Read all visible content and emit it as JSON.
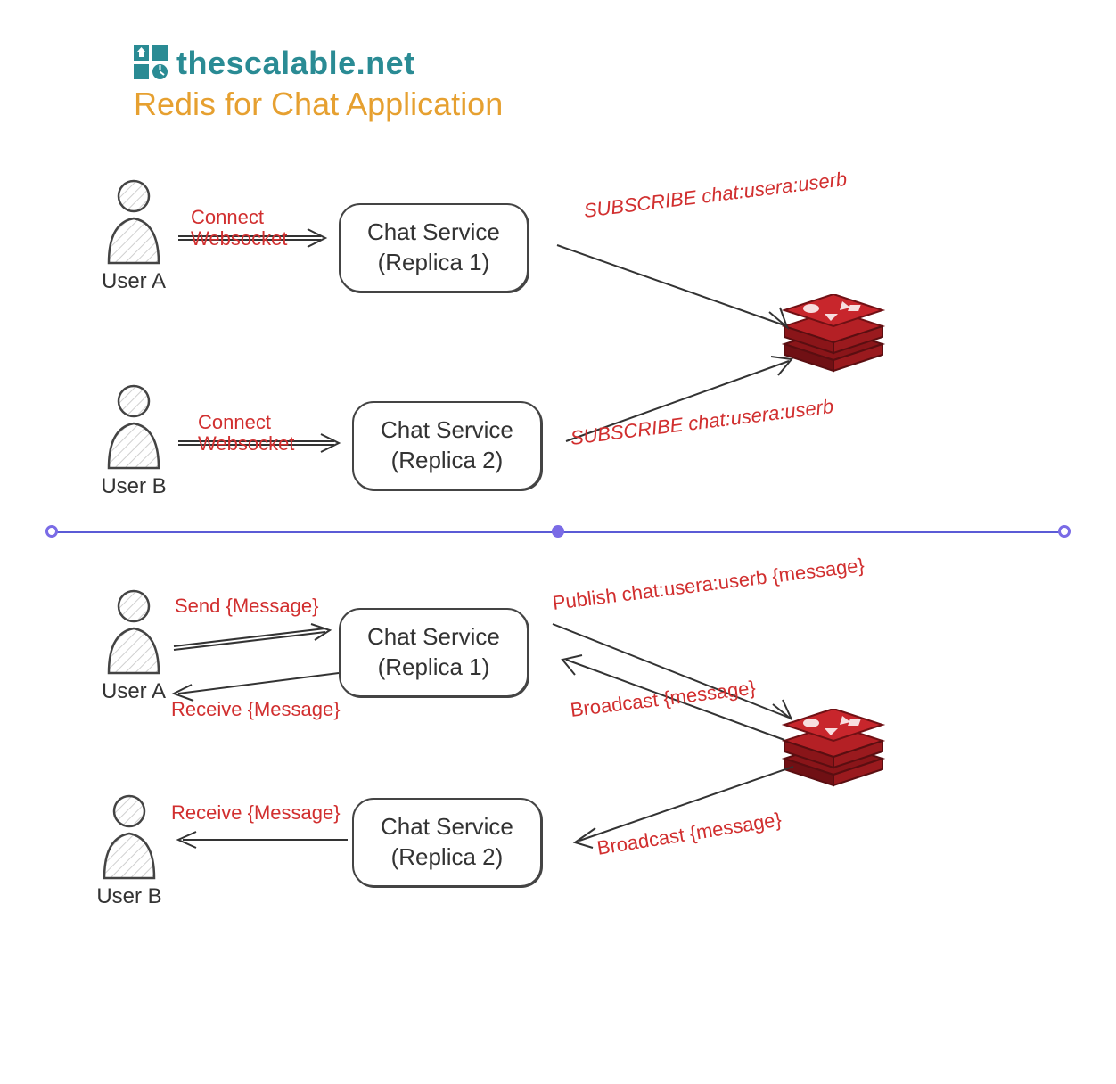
{
  "brand": "thescalable.net",
  "title": "Redis for Chat Application",
  "colors": {
    "brand_teal": "#2a8b94",
    "title_orange": "#e6a030",
    "annotation_red": "#d12f2f",
    "redis_red": "#b42025",
    "divider_purple": "#7a6be6",
    "stroke_black": "#333"
  },
  "top": {
    "userA": {
      "label": "User A"
    },
    "userB": {
      "label": "User B"
    },
    "svc1": {
      "line1": "Chat Service",
      "line2": "(Replica 1)"
    },
    "svc2": {
      "line1": "Chat Service",
      "line2": "(Replica 2)"
    },
    "ann_userA": "Connect\nWebsocket",
    "ann_userB": "Connect\nWebsocket",
    "ann_sub1": "SUBSCRIBE chat:usera:userb",
    "ann_sub2": "SUBSCRIBE chat:usera:userb"
  },
  "bottom": {
    "userA": {
      "label": "User A"
    },
    "userB": {
      "label": "User B"
    },
    "svc1": {
      "line1": "Chat Service",
      "line2": "(Replica 1)"
    },
    "svc2": {
      "line1": "Chat Service",
      "line2": "(Replica 2)"
    },
    "ann_send": "Send {Message}",
    "ann_recvA": "Receive {Message}",
    "ann_recvB": "Receive {Message}",
    "ann_publish": "Publish chat:usera:userb {message}",
    "ann_broadcast1": "Broadcast {message}",
    "ann_broadcast2": "Broadcast {message}"
  }
}
